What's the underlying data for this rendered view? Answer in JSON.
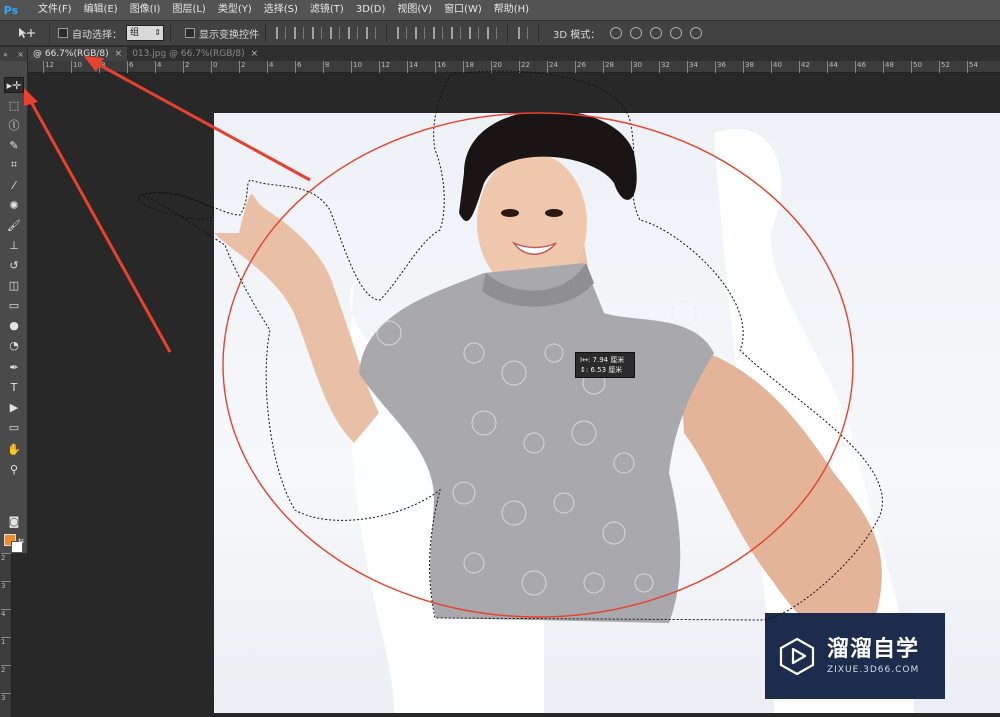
{
  "app": {
    "logo": "Ps",
    "menu": [
      "文件(F)",
      "编辑(E)",
      "图像(I)",
      "图层(L)",
      "类型(Y)",
      "选择(S)",
      "滤镜(T)",
      "3D(D)",
      "视图(V)",
      "窗口(W)",
      "帮助(H)"
    ]
  },
  "options": {
    "tool_icon": "move-tool-icon",
    "auto_select_label": "自动选择：",
    "auto_select_value": "组",
    "show_transform_label": "显示变换控件",
    "mode_3d_label": "3D 模式："
  },
  "tabs": [
    {
      "label": "@ 66.7%(RGB/8)",
      "close": "×",
      "active": true
    },
    {
      "label": "013.jpg @ 66.7%(RGB/8)",
      "close": "×",
      "active": false
    }
  ],
  "ruler_top_labels": [
    "12",
    "10",
    "8",
    "6",
    "4",
    "2",
    "0",
    "2",
    "4",
    "6",
    "8",
    "10",
    "12",
    "14",
    "16",
    "18",
    "20",
    "22",
    "24",
    "26",
    "28",
    "30",
    "32",
    "34",
    "36",
    "38",
    "40",
    "42",
    "44",
    "46",
    "48",
    "50",
    "52",
    "54"
  ],
  "ruler_left_labels": [
    "2",
    "3",
    "4",
    "1",
    "2",
    "3",
    "4"
  ],
  "measure_tooltip": {
    "line1": "I↔: 7.94 厘米",
    "line2": "↕: 6.53 厘米"
  },
  "watermark": {
    "title": "溜溜自学",
    "subtitle": "ZIXUE.3D66.COM"
  },
  "colors": {
    "foreground": "#f08b2c",
    "background": "#ffffff",
    "annotation": "#e8412f"
  }
}
